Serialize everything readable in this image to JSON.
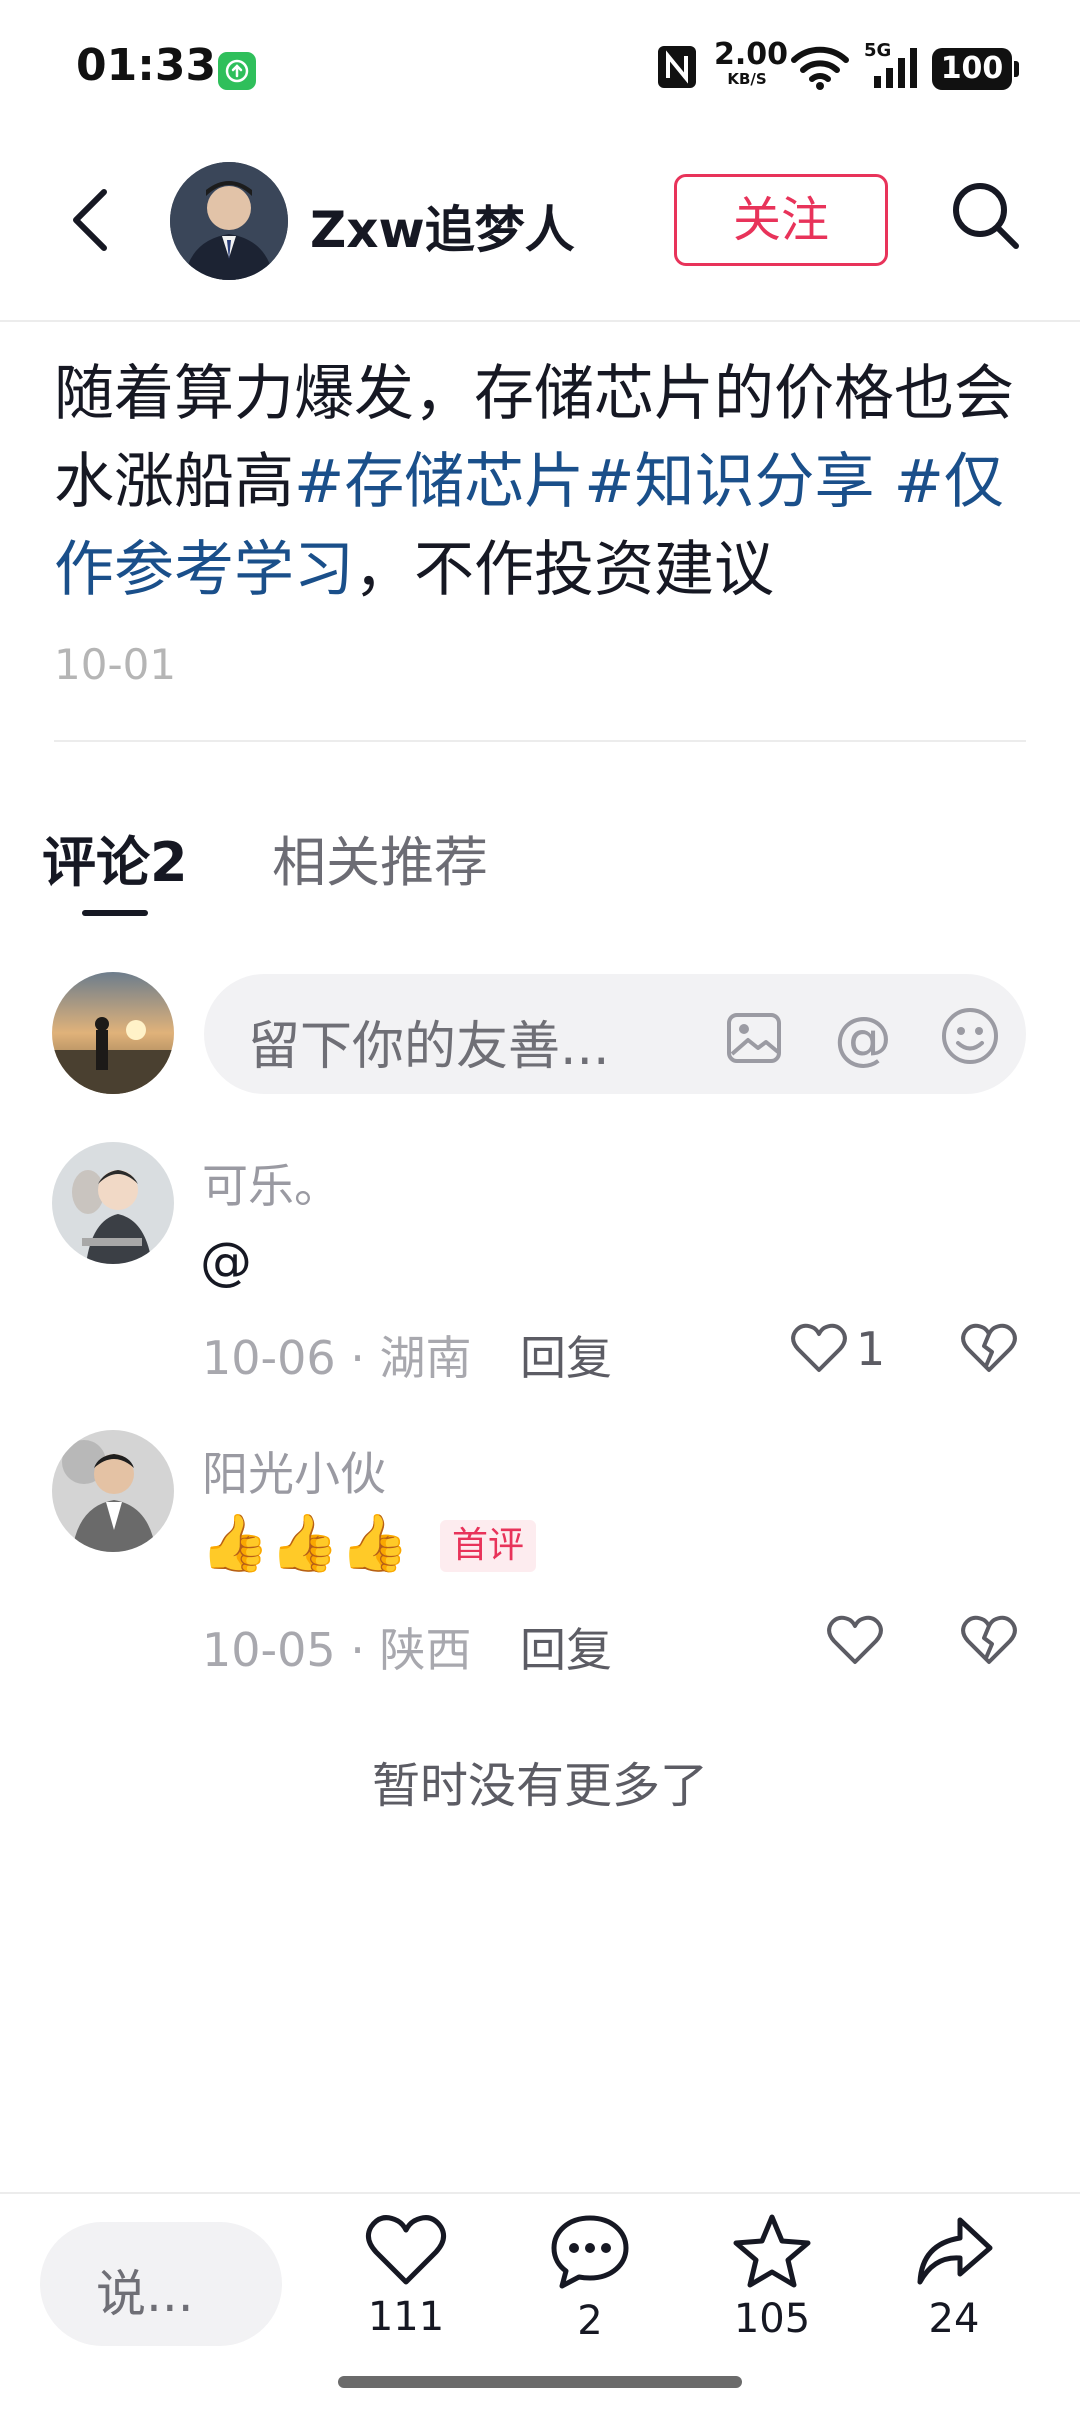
{
  "status_bar": {
    "time": "01:33",
    "net_speed_value": "2.00",
    "net_speed_unit": "KB/S",
    "signal_label": "5G",
    "battery": "100"
  },
  "header": {
    "author_name": "Zxw追梦人",
    "follow_label": "关注"
  },
  "post": {
    "text_part1": "随着算力爆发，存储芯片的价格也会水涨船高",
    "tag1": "#存储芯片",
    "tag2": "#知识分享",
    "tag3": "#仅作参考学习",
    "text_part2": "，不作投资建议",
    "date": "10-01"
  },
  "tabs": {
    "comments_label": "评论2",
    "related_label": "相关推荐"
  },
  "comment_input": {
    "placeholder": "留下你的友善...",
    "at_symbol": "@"
  },
  "comments": [
    {
      "name": "可乐。",
      "text": "@",
      "meta": "10-06 · 湖南",
      "reply_label": "回复",
      "like_count": "1"
    },
    {
      "name": "阳光小伙",
      "text": "👍👍👍",
      "badge": "首评",
      "meta": "10-05 · 陕西",
      "reply_label": "回复",
      "like_count": ""
    }
  ],
  "no_more_text": "暂时没有更多了",
  "bottom_bar": {
    "say_placeholder": "说...",
    "like_count": "111",
    "comment_count": "2",
    "favorite_count": "105",
    "share_count": "24"
  },
  "colors": {
    "accent": "#e8335a",
    "hashtag": "#1a4f8a",
    "text": "#161823"
  }
}
